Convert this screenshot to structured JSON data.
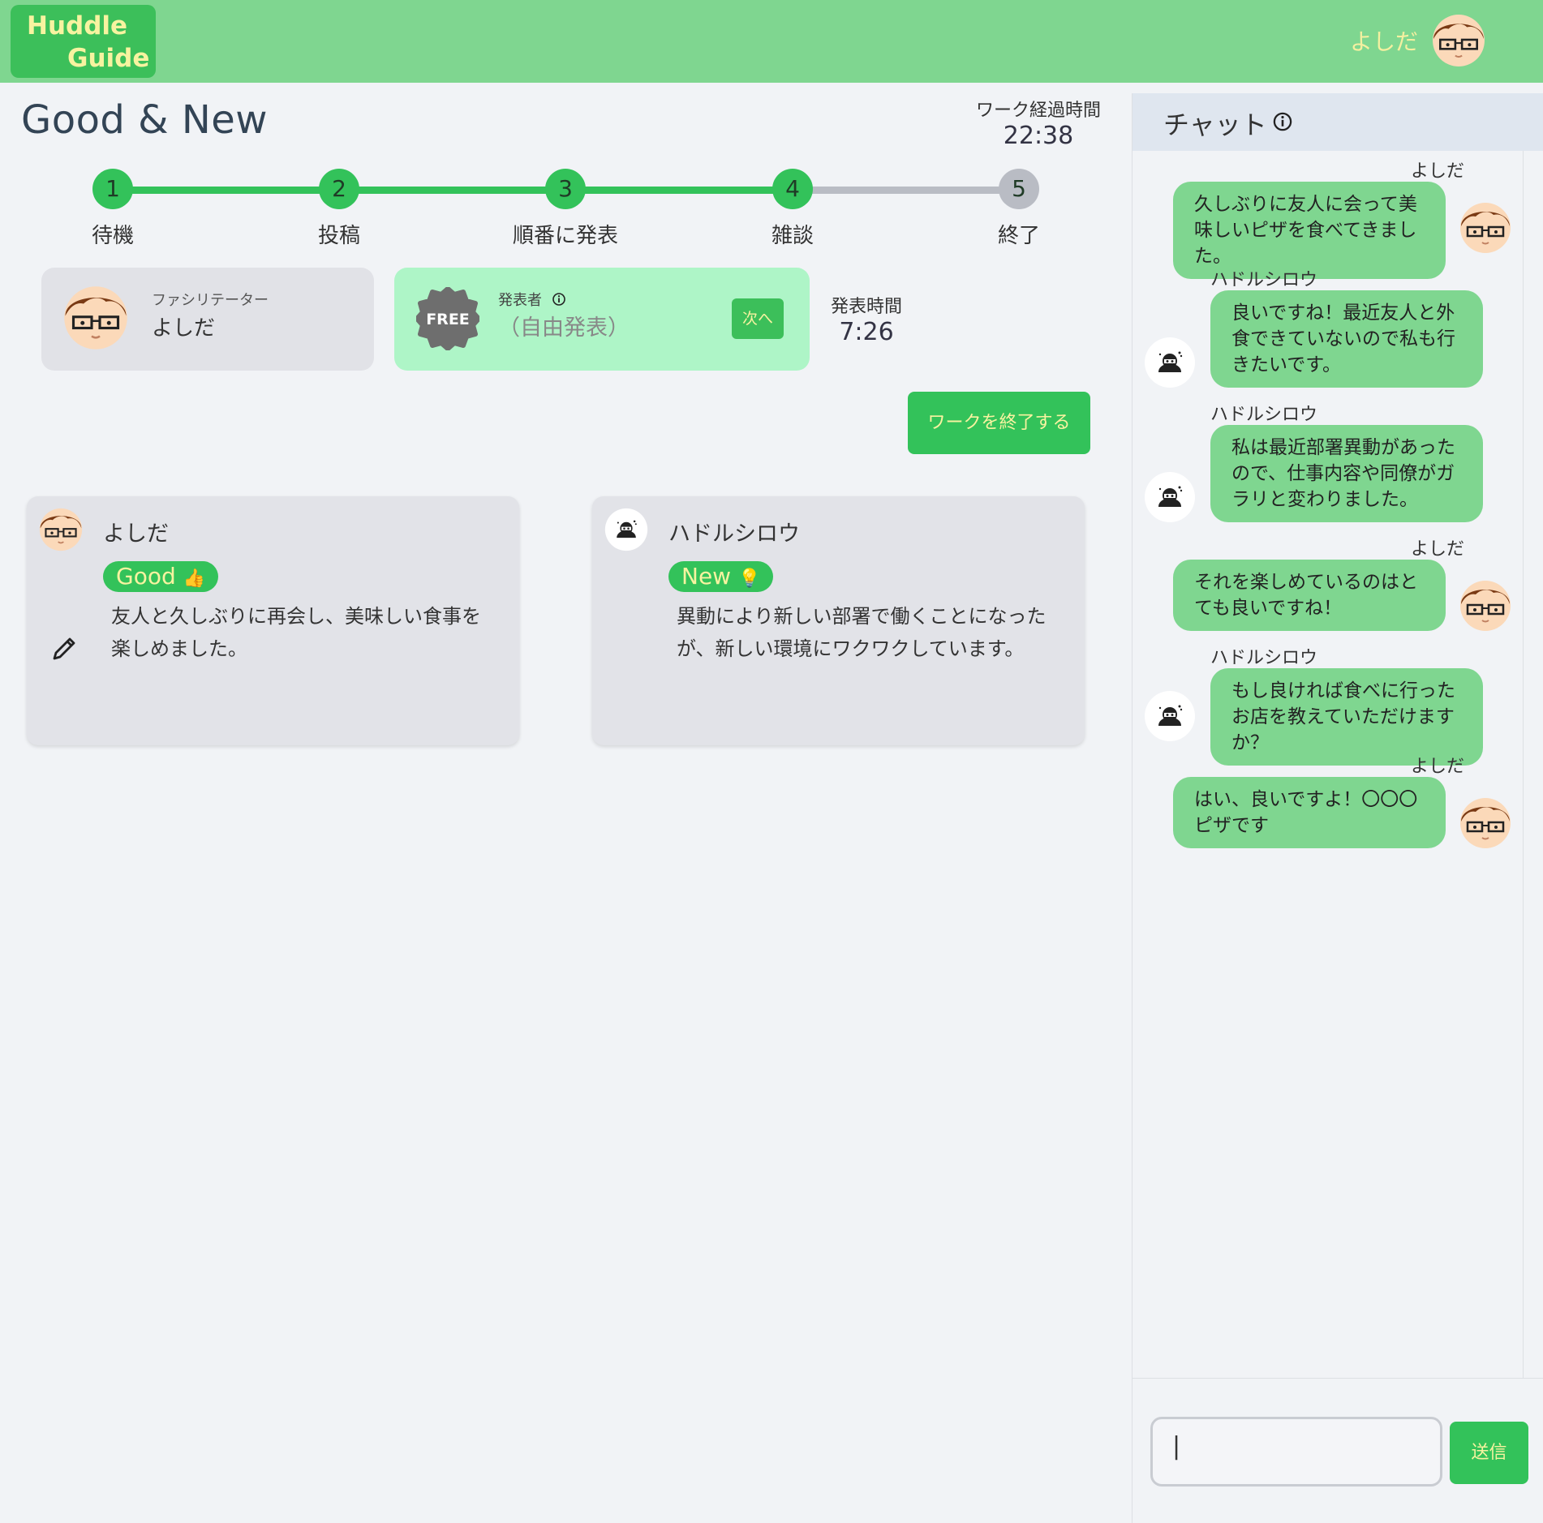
{
  "app": {
    "logo_line1": "Huddle",
    "logo_line2": "Guide",
    "user_name": "よしだ"
  },
  "main": {
    "title": "Good & New",
    "elapsed_label": "ワーク経過時間",
    "elapsed_value": "22:38",
    "steps": [
      {
        "num": "1",
        "label": "待機"
      },
      {
        "num": "2",
        "label": "投稿"
      },
      {
        "num": "3",
        "label": "順番に発表"
      },
      {
        "num": "4",
        "label": "雑談"
      },
      {
        "num": "5",
        "label": "終了"
      }
    ],
    "facilitator": {
      "role_label": "ファシリテーター",
      "name": "よしだ"
    },
    "presenter": {
      "badge": "FREE",
      "label": "発表者",
      "value": "（自由発表）",
      "next_label": "次へ"
    },
    "presentation_time_label": "発表時間",
    "presentation_time_value": "7:26",
    "end_work_label": "ワークを終了する",
    "posts": [
      {
        "author": "よしだ",
        "tag": "Good",
        "tag_emoji": "👍",
        "text": "友人と久しぶりに再会し、美味しい食事を楽しめました。"
      },
      {
        "author": "ハドルシロウ",
        "tag": "New",
        "tag_emoji": "💡",
        "text": "異動により新しい部署で働くことになったが、新しい環境にワクワクしています。"
      }
    ]
  },
  "chat": {
    "title": "チャット",
    "messages": [
      {
        "author": "よしだ",
        "text": "久しぶりに友人に会って美味しいピザを食べてきました。"
      },
      {
        "author": "ハドルシロウ",
        "text": "良いですね！最近友人と外食できていないので私も行きたいです。"
      },
      {
        "author": "ハドルシロウ",
        "text": "私は最近部署異動があったので、仕事内容や同僚がガラリと変わりました。"
      },
      {
        "author": "よしだ",
        "text": "それを楽しめているのはとても良いですね！"
      },
      {
        "author": "ハドルシロウ",
        "text": "もし良ければ食べに行ったお店を教えていただけますか？"
      },
      {
        "author": "よしだ",
        "text": "はい、良いですよ！〇〇〇ピザです"
      }
    ],
    "input_value": "|",
    "send_label": "送信"
  },
  "colors": {
    "header_bg": "#7fd690",
    "brand_green": "#33c25a",
    "bubble_green": "#7fd690",
    "presenter_card_bg": "#aef5c7",
    "text_yellow": "#f7f3a0"
  },
  "icons": [
    "avatar-yoshida",
    "avatar-hurdle-shirou",
    "info-icon",
    "free-badge",
    "pencil-icon"
  ]
}
